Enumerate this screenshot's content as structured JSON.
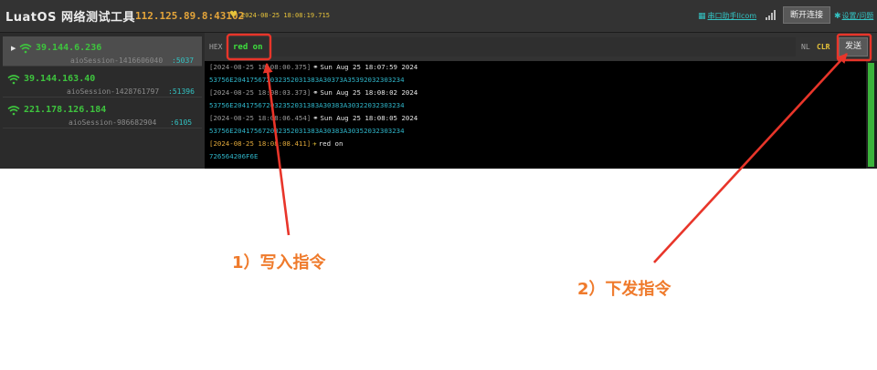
{
  "app": {
    "title": "LuatOS 网络测试工具",
    "server_address": "112.125.89.8:43102",
    "server_time": "2024-08-25 18:08:19.715"
  },
  "toolbar": {
    "com_helper_label": "串口助手llcom",
    "disconnect_label": "断开连接",
    "settings_label": "设置/问题"
  },
  "sessions": [
    {
      "ip": "39.144.6.236",
      "session_id": "aioSession-1416606040",
      "port": ":5037",
      "active": true
    },
    {
      "ip": "39.144.163.40",
      "session_id": "aioSession-1428761797",
      "port": ":51396",
      "active": false
    },
    {
      "ip": "221.178.126.184",
      "session_id": "aioSession-986682904",
      "port": ":6105",
      "active": false
    }
  ],
  "input": {
    "mode_label": "HEX",
    "value": "red on",
    "nl_label": "NL",
    "clr_label": "CLR",
    "send_label": "发送"
  },
  "log": [
    {
      "ts": "[2024-08-25 18:08:00.375]",
      "dir": "recv",
      "msg": "Sun Aug 25 18:07:59 2024",
      "hex": "53756E204175672032352031383A30373A35392032303234"
    },
    {
      "ts": "[2024-08-25 18:08:03.373]",
      "dir": "recv",
      "msg": "Sun Aug 25 18:08:02 2024",
      "hex": "53756E204175672032352031383A30383A30322032303234"
    },
    {
      "ts": "[2024-08-25 18:08:06.454]",
      "dir": "recv",
      "msg": "Sun Aug 25 18:08:05 2024",
      "hex": "53756E204175672032352031383A30383A30352032303234"
    },
    {
      "ts": "[2024-08-25 18:08:08.411]",
      "dir": "send",
      "msg": "red on",
      "hex": "726564206F6E"
    }
  ],
  "annotations": {
    "step1": "1）写入指令",
    "step2": "2）下发指令",
    "color": "#e8352a",
    "label_color": "#ef7a2b"
  },
  "colors": {
    "accent_green": "#3ec43e",
    "accent_cyan": "#33c3c3",
    "accent_yellow": "#e8c43a"
  }
}
